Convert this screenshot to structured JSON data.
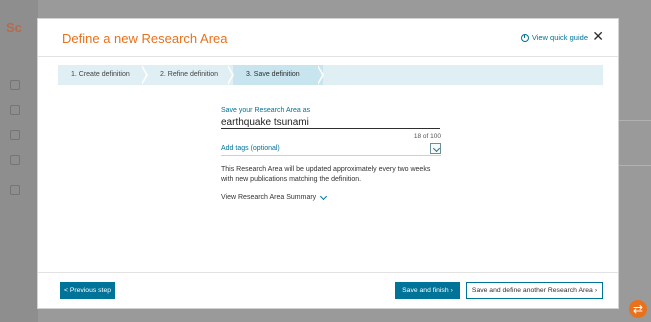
{
  "background": {
    "logo_text": "Sc",
    "shortcut_icon": "exchange-icon"
  },
  "modal": {
    "title": "Define a new Research Area",
    "quick_guide_label": "View quick guide",
    "close_label": "✕",
    "steps": [
      {
        "label": "1. Create definition",
        "state": "done"
      },
      {
        "label": "2. Refine definition",
        "state": "done"
      },
      {
        "label": "3. Save definition",
        "state": "active"
      }
    ],
    "form": {
      "save_as_label": "Save your Research Area as",
      "name_value": "earthquake tsunami",
      "char_count": "18 of 100",
      "tags_label": "Add tags (optional)",
      "notice": "This Research Area will be updated approximately every two weeks with new publications matching the definition.",
      "summary_link": "View Research Area Summary"
    },
    "footer": {
      "previous_label": "< Previous step",
      "finish_label": "Save and finish",
      "another_label": "Save and define another Research Area"
    }
  },
  "colors": {
    "accent": "#e9711c",
    "primary": "#007398",
    "step_bg": "#e0eff4",
    "step_active": "#c8e4ee"
  }
}
